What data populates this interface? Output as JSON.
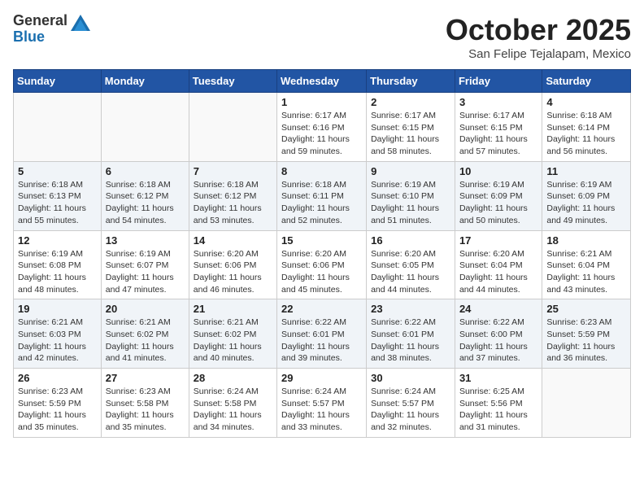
{
  "logo": {
    "general": "General",
    "blue": "Blue"
  },
  "title": "October 2025",
  "location": "San Felipe Tejalapam, Mexico",
  "days_of_week": [
    "Sunday",
    "Monday",
    "Tuesday",
    "Wednesday",
    "Thursday",
    "Friday",
    "Saturday"
  ],
  "weeks": [
    [
      {
        "day": "",
        "info": ""
      },
      {
        "day": "",
        "info": ""
      },
      {
        "day": "",
        "info": ""
      },
      {
        "day": "1",
        "info": "Sunrise: 6:17 AM\nSunset: 6:16 PM\nDaylight: 11 hours\nand 59 minutes."
      },
      {
        "day": "2",
        "info": "Sunrise: 6:17 AM\nSunset: 6:15 PM\nDaylight: 11 hours\nand 58 minutes."
      },
      {
        "day": "3",
        "info": "Sunrise: 6:17 AM\nSunset: 6:15 PM\nDaylight: 11 hours\nand 57 minutes."
      },
      {
        "day": "4",
        "info": "Sunrise: 6:18 AM\nSunset: 6:14 PM\nDaylight: 11 hours\nand 56 minutes."
      }
    ],
    [
      {
        "day": "5",
        "info": "Sunrise: 6:18 AM\nSunset: 6:13 PM\nDaylight: 11 hours\nand 55 minutes."
      },
      {
        "day": "6",
        "info": "Sunrise: 6:18 AM\nSunset: 6:12 PM\nDaylight: 11 hours\nand 54 minutes."
      },
      {
        "day": "7",
        "info": "Sunrise: 6:18 AM\nSunset: 6:12 PM\nDaylight: 11 hours\nand 53 minutes."
      },
      {
        "day": "8",
        "info": "Sunrise: 6:18 AM\nSunset: 6:11 PM\nDaylight: 11 hours\nand 52 minutes."
      },
      {
        "day": "9",
        "info": "Sunrise: 6:19 AM\nSunset: 6:10 PM\nDaylight: 11 hours\nand 51 minutes."
      },
      {
        "day": "10",
        "info": "Sunrise: 6:19 AM\nSunset: 6:09 PM\nDaylight: 11 hours\nand 50 minutes."
      },
      {
        "day": "11",
        "info": "Sunrise: 6:19 AM\nSunset: 6:09 PM\nDaylight: 11 hours\nand 49 minutes."
      }
    ],
    [
      {
        "day": "12",
        "info": "Sunrise: 6:19 AM\nSunset: 6:08 PM\nDaylight: 11 hours\nand 48 minutes."
      },
      {
        "day": "13",
        "info": "Sunrise: 6:19 AM\nSunset: 6:07 PM\nDaylight: 11 hours\nand 47 minutes."
      },
      {
        "day": "14",
        "info": "Sunrise: 6:20 AM\nSunset: 6:06 PM\nDaylight: 11 hours\nand 46 minutes."
      },
      {
        "day": "15",
        "info": "Sunrise: 6:20 AM\nSunset: 6:06 PM\nDaylight: 11 hours\nand 45 minutes."
      },
      {
        "day": "16",
        "info": "Sunrise: 6:20 AM\nSunset: 6:05 PM\nDaylight: 11 hours\nand 44 minutes."
      },
      {
        "day": "17",
        "info": "Sunrise: 6:20 AM\nSunset: 6:04 PM\nDaylight: 11 hours\nand 44 minutes."
      },
      {
        "day": "18",
        "info": "Sunrise: 6:21 AM\nSunset: 6:04 PM\nDaylight: 11 hours\nand 43 minutes."
      }
    ],
    [
      {
        "day": "19",
        "info": "Sunrise: 6:21 AM\nSunset: 6:03 PM\nDaylight: 11 hours\nand 42 minutes."
      },
      {
        "day": "20",
        "info": "Sunrise: 6:21 AM\nSunset: 6:02 PM\nDaylight: 11 hours\nand 41 minutes."
      },
      {
        "day": "21",
        "info": "Sunrise: 6:21 AM\nSunset: 6:02 PM\nDaylight: 11 hours\nand 40 minutes."
      },
      {
        "day": "22",
        "info": "Sunrise: 6:22 AM\nSunset: 6:01 PM\nDaylight: 11 hours\nand 39 minutes."
      },
      {
        "day": "23",
        "info": "Sunrise: 6:22 AM\nSunset: 6:01 PM\nDaylight: 11 hours\nand 38 minutes."
      },
      {
        "day": "24",
        "info": "Sunrise: 6:22 AM\nSunset: 6:00 PM\nDaylight: 11 hours\nand 37 minutes."
      },
      {
        "day": "25",
        "info": "Sunrise: 6:23 AM\nSunset: 5:59 PM\nDaylight: 11 hours\nand 36 minutes."
      }
    ],
    [
      {
        "day": "26",
        "info": "Sunrise: 6:23 AM\nSunset: 5:59 PM\nDaylight: 11 hours\nand 35 minutes."
      },
      {
        "day": "27",
        "info": "Sunrise: 6:23 AM\nSunset: 5:58 PM\nDaylight: 11 hours\nand 35 minutes."
      },
      {
        "day": "28",
        "info": "Sunrise: 6:24 AM\nSunset: 5:58 PM\nDaylight: 11 hours\nand 34 minutes."
      },
      {
        "day": "29",
        "info": "Sunrise: 6:24 AM\nSunset: 5:57 PM\nDaylight: 11 hours\nand 33 minutes."
      },
      {
        "day": "30",
        "info": "Sunrise: 6:24 AM\nSunset: 5:57 PM\nDaylight: 11 hours\nand 32 minutes."
      },
      {
        "day": "31",
        "info": "Sunrise: 6:25 AM\nSunset: 5:56 PM\nDaylight: 11 hours\nand 31 minutes."
      },
      {
        "day": "",
        "info": ""
      }
    ]
  ]
}
